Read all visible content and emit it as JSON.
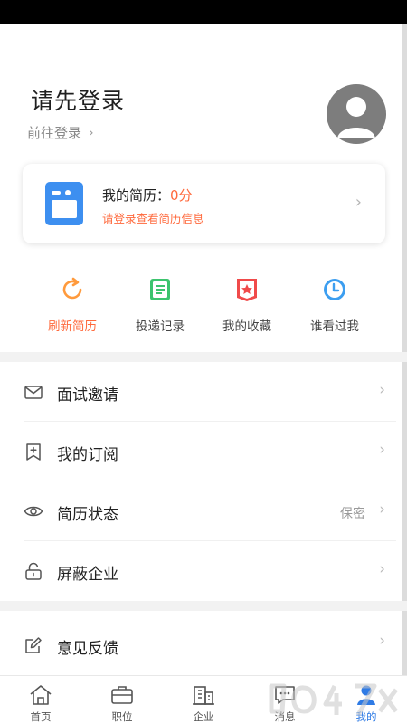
{
  "header": {
    "title": "请先登录",
    "login_link": "前往登录"
  },
  "resume_card": {
    "title": "我的简历：",
    "score": "0分",
    "subtitle": "请登录查看简历信息"
  },
  "quick_actions": [
    {
      "label": "刷新简历",
      "icon": "refresh-icon",
      "color": "#ff9a3c"
    },
    {
      "label": "投递记录",
      "icon": "document-list-icon",
      "color": "#3cc46e"
    },
    {
      "label": "我的收藏",
      "icon": "star-badge-icon",
      "color": "#f04a4a"
    },
    {
      "label": "谁看过我",
      "icon": "clock-icon",
      "color": "#3c9ef0"
    }
  ],
  "menu": [
    {
      "label": "面试邀请",
      "icon": "envelope-icon",
      "value": ""
    },
    {
      "label": "我的订阅",
      "icon": "bookmark-add-icon",
      "value": ""
    },
    {
      "label": "简历状态",
      "icon": "eye-icon",
      "value": "保密"
    },
    {
      "label": "屏蔽企业",
      "icon": "lock-icon",
      "value": ""
    },
    {
      "label": "意见反馈",
      "icon": "edit-icon",
      "value": ""
    }
  ],
  "tabs": [
    {
      "label": "首页",
      "icon": "home-icon",
      "active": false
    },
    {
      "label": "职位",
      "icon": "briefcase-icon",
      "active": false
    },
    {
      "label": "企业",
      "icon": "building-icon",
      "active": false
    },
    {
      "label": "消息",
      "icon": "chat-icon",
      "active": false
    },
    {
      "label": "我的",
      "icon": "user-icon",
      "active": true
    }
  ],
  "colors": {
    "accent": "#ff6a3d",
    "active_tab": "#2f7be5",
    "avatar": "#7d7d7d",
    "resume_icon": "#3d8ff0"
  }
}
